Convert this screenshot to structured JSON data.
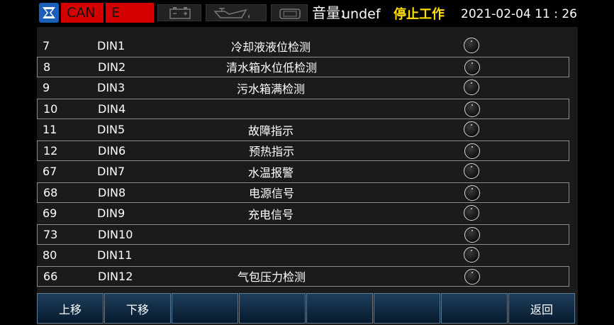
{
  "status_bar": {
    "can_label": "CAN",
    "e_label": "E",
    "volume_label": "音量:",
    "volume_value": "undef",
    "work_state": "停止工作",
    "datetime": "2021-02-04  11 : 26",
    "icons": [
      "logo-icon",
      "battery-icon",
      "oil-pressure-icon",
      "charging-icon"
    ],
    "colors": {
      "alarm_red": "#d40000",
      "state_yellow": "#ffe000",
      "logo_blue": "#1c5fb8"
    }
  },
  "rows": [
    {
      "num": "7",
      "din": "DIN1",
      "desc": "冷却液液位检测"
    },
    {
      "num": "8",
      "din": "DIN2",
      "desc": "清水箱水位低检测"
    },
    {
      "num": "9",
      "din": "DIN3",
      "desc": "污水箱满检测"
    },
    {
      "num": "10",
      "din": "DIN4",
      "desc": ""
    },
    {
      "num": "11",
      "din": "DIN5",
      "desc": "故障指示"
    },
    {
      "num": "12",
      "din": "DIN6",
      "desc": "预热指示"
    },
    {
      "num": "67",
      "din": "DIN7",
      "desc": "水温报警"
    },
    {
      "num": "68",
      "din": "DIN8",
      "desc": "电源信号"
    },
    {
      "num": "69",
      "din": "DIN9",
      "desc": "充电信号"
    },
    {
      "num": "73",
      "din": "DIN10",
      "desc": ""
    },
    {
      "num": "80",
      "din": "DIN11",
      "desc": ""
    },
    {
      "num": "66",
      "din": "DIN12",
      "desc": "气包压力检测"
    }
  ],
  "buttons": [
    "上移",
    "下移",
    "",
    "",
    "",
    "",
    "",
    "返回"
  ]
}
